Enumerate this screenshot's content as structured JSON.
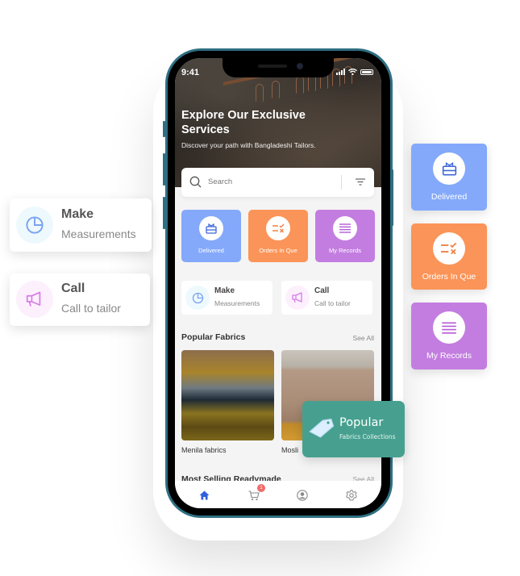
{
  "colors": {
    "delivered": "#84a9fb",
    "orders": "#fb9458",
    "records": "#c37de0",
    "popular_tag": "#47a08f",
    "phone_frame": "#2f6f82",
    "nav_active": "#2f5fdc",
    "badge": "#ef6b6b"
  },
  "status_bar": {
    "time": "9:41"
  },
  "hero": {
    "title": "Explore Our Exclusive Services",
    "subtitle": "Discover your path with Bangladeshi Tailors."
  },
  "search": {
    "placeholder": "Search",
    "icon": "search-icon",
    "filter_icon": "filter-icon"
  },
  "categories": [
    {
      "label": "Delivered",
      "icon": "gift-box-icon"
    },
    {
      "label": "Orders In Que",
      "icon": "checklist-icon"
    },
    {
      "label": "My Records",
      "icon": "list-lines-icon"
    }
  ],
  "quick_actions": [
    {
      "title": "Make",
      "subtitle": "Measurements",
      "icon": "pie-chart-icon"
    },
    {
      "title": "Call",
      "subtitle": "Call to tailor",
      "icon": "megaphone-icon"
    }
  ],
  "popular_fabrics": {
    "title": "Popular Fabrics",
    "see_all": "See All",
    "items": [
      {
        "label": "Menila fabrics"
      },
      {
        "label": "Mosli"
      }
    ]
  },
  "most_selling": {
    "title": "Most Selling Readymade",
    "see_all": "See All"
  },
  "bottom_nav": {
    "items": [
      {
        "name": "home",
        "icon": "home-icon",
        "active": true
      },
      {
        "name": "cart",
        "icon": "cart-icon",
        "badge": "1"
      },
      {
        "name": "profile",
        "icon": "user-icon"
      },
      {
        "name": "settings",
        "icon": "gear-icon"
      }
    ]
  },
  "floating_left": [
    {
      "title": "Make",
      "subtitle": "Measurements",
      "icon": "pie-chart-icon"
    },
    {
      "title": "Call",
      "subtitle": "Call to tailor",
      "icon": "megaphone-icon"
    }
  ],
  "floating_right": [
    {
      "label": "Delivered",
      "icon": "gift-box-icon"
    },
    {
      "label": "Orders In Que",
      "icon": "checklist-icon"
    },
    {
      "label": "My Records",
      "icon": "list-lines-icon"
    }
  ],
  "popular_tag": {
    "title": "Popular",
    "subtitle": "Fabrics Collections",
    "icon": "price-tag-icon"
  }
}
